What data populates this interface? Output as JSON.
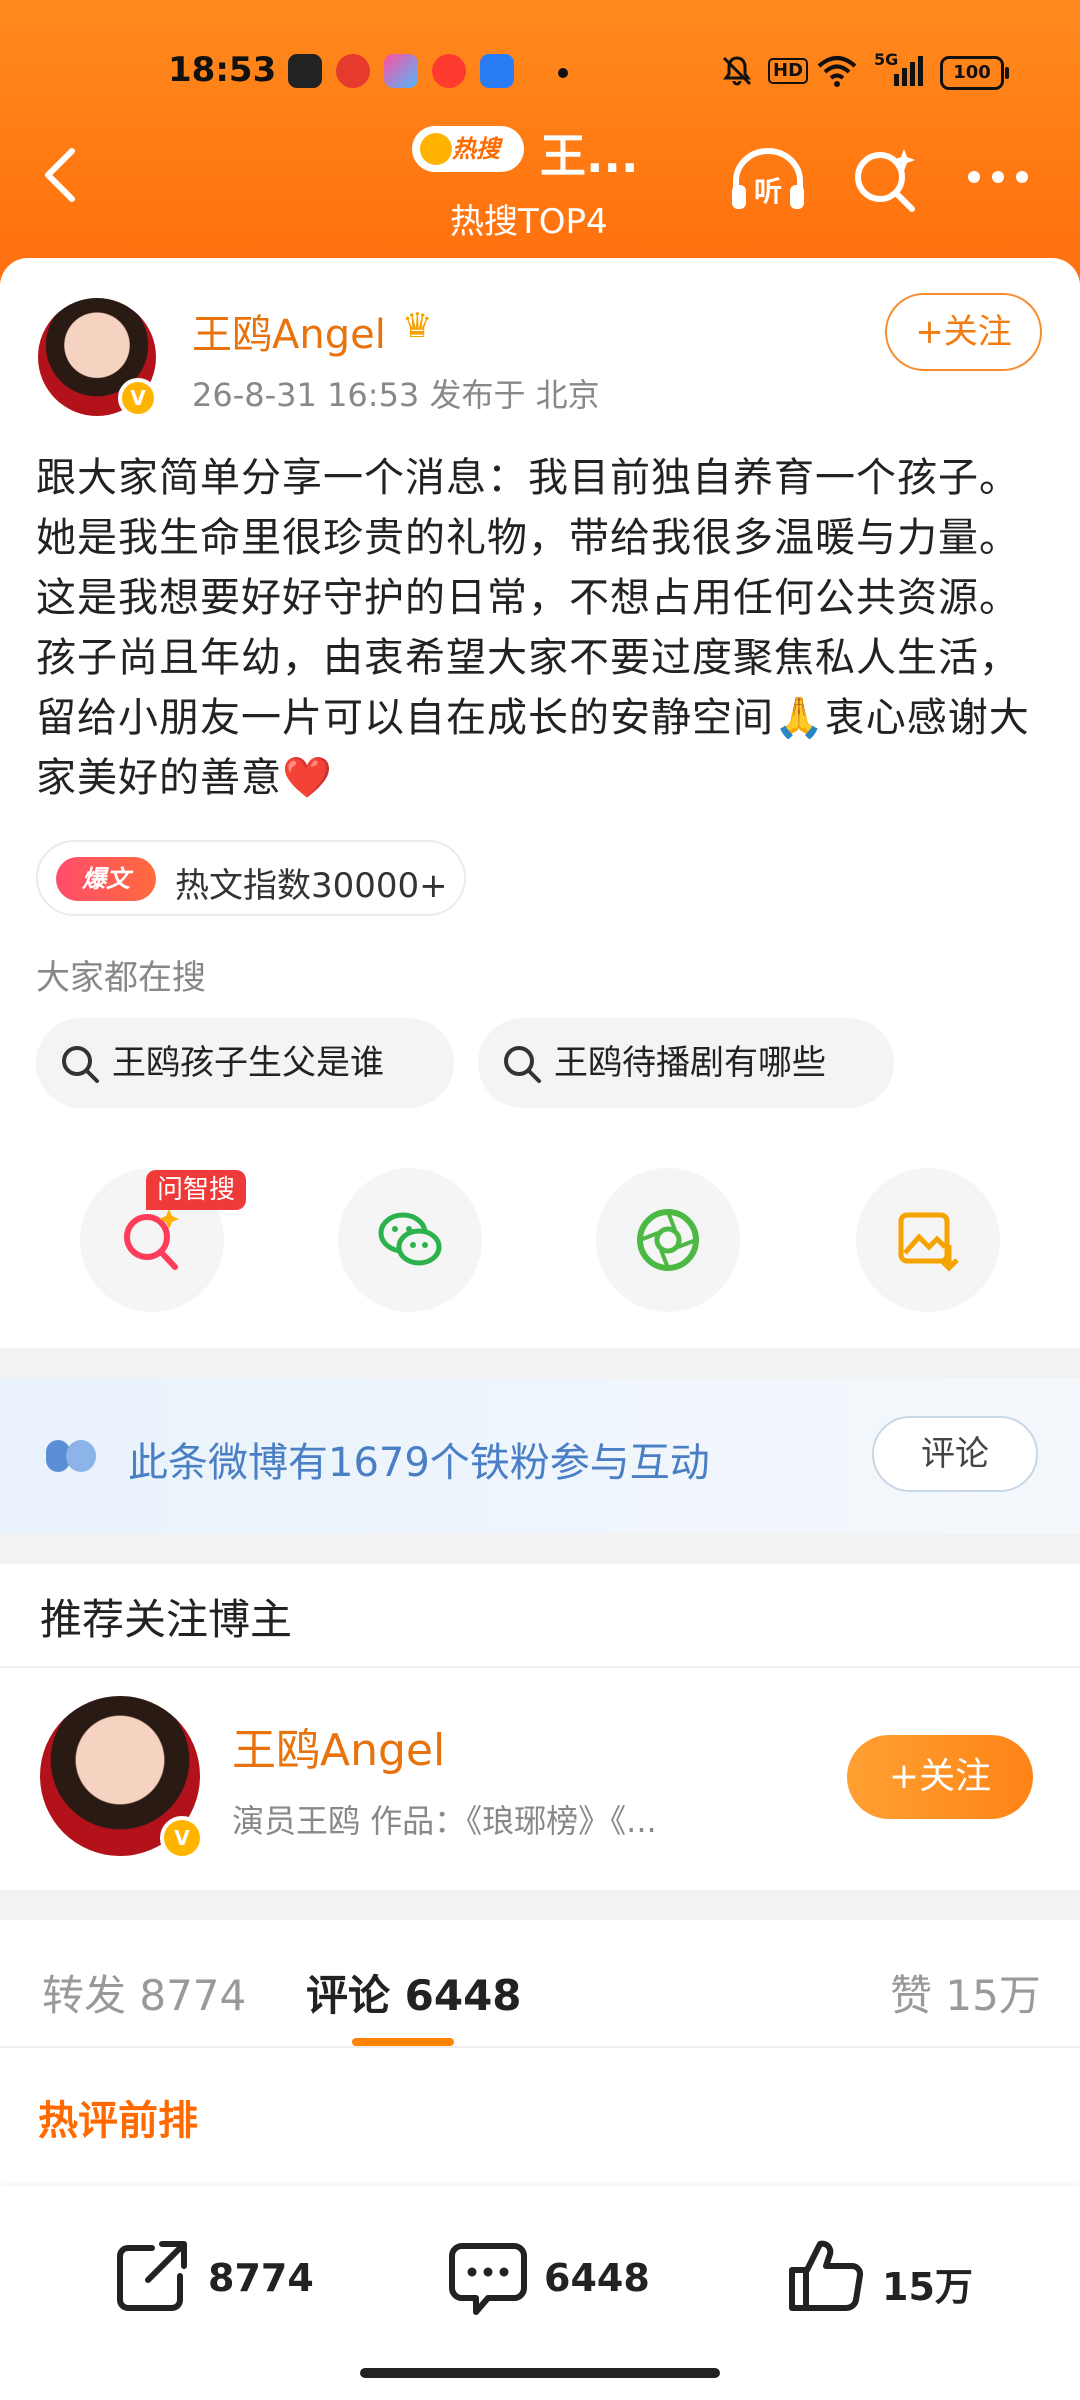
{
  "status_bar": {
    "time": "18:53",
    "battery": "100",
    "signal_text": "5G",
    "hd_text": "HD"
  },
  "nav": {
    "hot_badge": "热搜",
    "title": "王...",
    "subtitle": "热搜TOP4",
    "listen_label": "听"
  },
  "post": {
    "author": "王鸥Angel",
    "meta": "26-8-31 16:53  发布于 北京",
    "follow_label": "+关注",
    "content": "跟大家简单分享一个消息：我目前独自养育一个孩子。她是我生命里很珍贵的礼物，带给我很多温暖与力量。这是我想要好好守护的日常，不想占用任何公共资源。孩子尚且年幼，由衷希望大家不要过度聚焦私人生活，留给小朋友一片可以自在成长的安静空间🙏衷心感谢大家美好的善意❤️",
    "hot_tag": "爆文",
    "hot_index": "热文指数30000+",
    "search_label": "大家都在搜",
    "search_chips": [
      "王鸥孩子生父是谁",
      "王鸥待播剧有哪些"
    ],
    "ask_tag": "问智搜"
  },
  "fans_banner": {
    "text": "此条微博有1679个铁粉参与互动",
    "button": "评论"
  },
  "recommend": {
    "title": "推荐关注博主",
    "name": "王鸥Angel",
    "desc": "演员王鸥 作品：《琅琊榜》《...",
    "follow_label": "+关注"
  },
  "tabs": {
    "repost": "转发 8774",
    "comment": "评论 6448",
    "like": "赞 15万",
    "hot_comments": "热评前排"
  },
  "bottom_bar": {
    "repost_count": "8774",
    "comment_count": "6448",
    "like_count": "15万"
  },
  "colors": {
    "header_orange": "#ff7a12",
    "author_orange": "#e8730c",
    "fans_blue": "#4a7fc6"
  }
}
